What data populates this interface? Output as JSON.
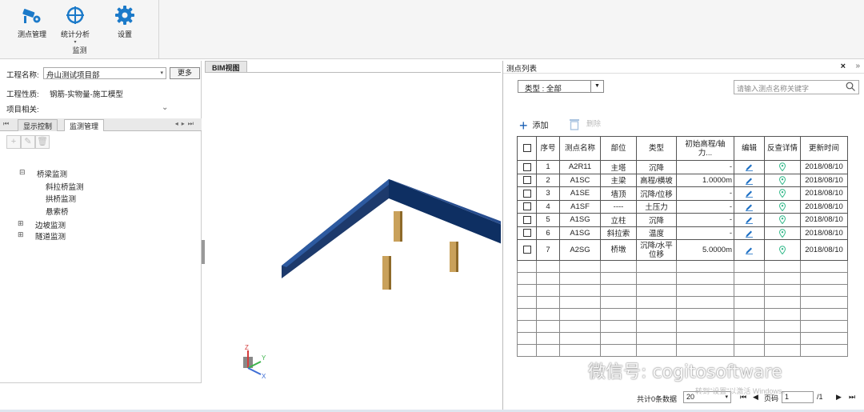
{
  "ribbon": {
    "buttons": [
      {
        "label": "测点管理",
        "icon": "camera-gear-icon"
      },
      {
        "label": "统计分析",
        "icon": "crosshair-icon"
      },
      {
        "label": "设置",
        "icon": "gear-icon"
      }
    ],
    "group_label": "监测"
  },
  "left": {
    "project_name_label": "工程名称:",
    "project_name_value": "舟山测试项目部",
    "more_button": "更多",
    "project_nature_label": "工程性质:",
    "project_nature_value": "钢筋-实物量-施工模型",
    "project_related_label": "项目相关:",
    "tabs": [
      "显示控制",
      "监测管理"
    ],
    "tree": [
      {
        "label": "桥梁监测",
        "toggle": "⊟"
      },
      {
        "label": "斜拉桥监测"
      },
      {
        "label": "拱桥监测"
      },
      {
        "label": "悬索桥"
      },
      {
        "label": "边坡监测",
        "toggle": "⊞"
      },
      {
        "label": "隧道监测",
        "toggle": "⊞"
      }
    ]
  },
  "bim": {
    "tab": "BIM视图",
    "axes": {
      "z": "Z",
      "y": "Y",
      "x": "X"
    }
  },
  "right": {
    "title": "测点列表",
    "type_filter": "类型 :  全部",
    "search_placeholder": "请输入测点名称关键字",
    "add_label": "添加",
    "delete_label": "删除",
    "columns": [
      "序号",
      "测点名称",
      "部位",
      "类型",
      "初始高程/轴力...",
      "编辑",
      "反查详情",
      "更新时间"
    ],
    "rows": [
      {
        "no": "1",
        "name": "A2R11",
        "part": "主塔",
        "type": "沉降",
        "init": "-",
        "date": "2018/08/10"
      },
      {
        "no": "2",
        "name": "A1SC",
        "part": "主梁",
        "type": "高程/横坡",
        "init": "1.0000m",
        "date": "2018/08/10"
      },
      {
        "no": "3",
        "name": "A1SE",
        "part": "墙顶",
        "type": "沉降/位移",
        "init": "-",
        "date": "2018/08/10"
      },
      {
        "no": "4",
        "name": "A1SF",
        "part": "----",
        "type": "土压力",
        "init": "-",
        "date": "2018/08/10"
      },
      {
        "no": "5",
        "name": "A1SG",
        "part": "立柱",
        "type": "沉降",
        "init": "-",
        "date": "2018/08/10"
      },
      {
        "no": "6",
        "name": "A1SG",
        "part": "斜拉索",
        "type": "温度",
        "init": "-",
        "date": "2018/08/10"
      },
      {
        "no": "7",
        "name": "A2SG",
        "part": "桥墩",
        "type": "沉降/水平位移",
        "init": "5.0000m",
        "date": "2018/08/10"
      }
    ],
    "pager": {
      "total": "共计0条数据",
      "page_size": "20",
      "page_label": "页码",
      "page_value": "1",
      "page_total": "/1"
    }
  },
  "watermark": "微信号: cogitosoftware",
  "watermark_sub": "转到\"设置\"以激活 Windows。"
}
